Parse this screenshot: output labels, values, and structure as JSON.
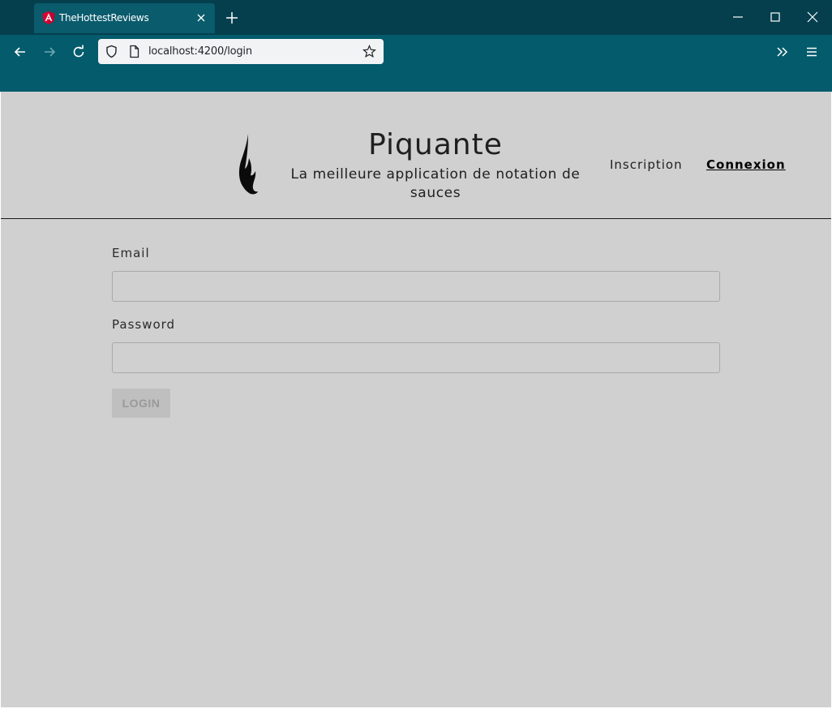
{
  "browser": {
    "tab_title": "TheHottestReviews",
    "url": "localhost:4200/login"
  },
  "header": {
    "brand_title": "Piquante",
    "tagline": "La meilleure application de notation de sauces",
    "nav": {
      "signup": "Inscription",
      "login": "Connexion"
    }
  },
  "form": {
    "email_label": "Email",
    "email_value": "",
    "password_label": "Password",
    "password_value": "",
    "submit_label": "LOGIN"
  },
  "colors": {
    "titlebar": "#053f4e",
    "navbar": "#035b6b",
    "page_background": "#d0d0d0",
    "disabled_button": "#bfbfbf"
  }
}
